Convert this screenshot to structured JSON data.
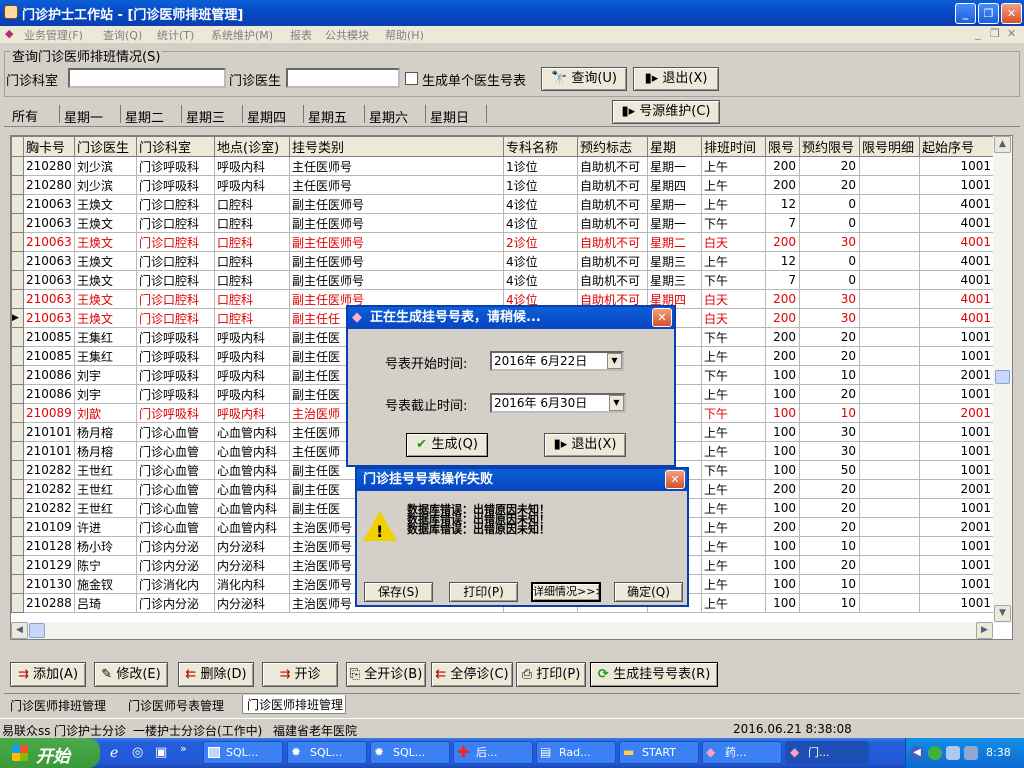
{
  "window": {
    "title": "门诊护士工作站 - [门诊医师排班管理]"
  },
  "menu": [
    {
      "label": "业务管理(F)"
    },
    {
      "label": "查询(Q)"
    },
    {
      "label": "统计(T)"
    },
    {
      "label": "系统维护(M)"
    },
    {
      "label": "报表"
    },
    {
      "label": "公共模块"
    },
    {
      "label": "帮助(H)"
    }
  ],
  "query": {
    "group_label": "查询门诊医师排班情况(S)",
    "dept_label": "门诊科室",
    "dept_value": "",
    "doctor_label": "门诊医生",
    "doctor_value": "",
    "single_checkbox_label": "生成单个医生号表",
    "query_button": "查询(U)",
    "exit_button": "退出(X)"
  },
  "day_tabs": [
    "所有",
    "星期一",
    "星期二",
    "星期三",
    "星期四",
    "星期五",
    "星期六",
    "星期日"
  ],
  "source_button": "号源维护(C)",
  "table": {
    "columns": [
      "胸卡号",
      "门诊医生",
      "门诊科室",
      "地点(诊室)",
      "挂号类别",
      "专科名称",
      "预约标志",
      "星期",
      "排班时间",
      "限号",
      "预约限号",
      "限号明细",
      "起始序号"
    ],
    "rows": [
      {
        "c": [
          "210280",
          "刘少滨",
          "门诊呼吸科",
          "呼吸内科",
          "主任医师号",
          "1诊位",
          "自助机不可",
          "星期一",
          "上午",
          "200",
          "20",
          "",
          "1001"
        ],
        "red": false
      },
      {
        "c": [
          "210280",
          "刘少滨",
          "门诊呼吸科",
          "呼吸内科",
          "主任医师号",
          "1诊位",
          "自助机不可",
          "星期四",
          "上午",
          "200",
          "20",
          "",
          "1001"
        ],
        "red": false
      },
      {
        "c": [
          "210063",
          "王焕文",
          "门诊口腔科",
          "口腔科",
          "副主任医师号",
          "4诊位",
          "自助机不可",
          "星期一",
          "上午",
          "12",
          "0",
          "",
          "4001"
        ],
        "red": false
      },
      {
        "c": [
          "210063",
          "王焕文",
          "门诊口腔科",
          "口腔科",
          "副主任医师号",
          "4诊位",
          "自助机不可",
          "星期一",
          "下午",
          "7",
          "0",
          "",
          "4001"
        ],
        "red": false
      },
      {
        "c": [
          "210063",
          "王焕文",
          "门诊口腔科",
          "口腔科",
          "副主任医师号",
          "2诊位",
          "自助机不可",
          "星期二",
          "白天",
          "200",
          "30",
          "",
          "4001"
        ],
        "red": true
      },
      {
        "c": [
          "210063",
          "王焕文",
          "门诊口腔科",
          "口腔科",
          "副主任医师号",
          "4诊位",
          "自助机不可",
          "星期三",
          "上午",
          "12",
          "0",
          "",
          "4001"
        ],
        "red": false
      },
      {
        "c": [
          "210063",
          "王焕文",
          "门诊口腔科",
          "口腔科",
          "副主任医师号",
          "4诊位",
          "自助机不可",
          "星期三",
          "下午",
          "7",
          "0",
          "",
          "4001"
        ],
        "red": false
      },
      {
        "c": [
          "210063",
          "王焕文",
          "门诊口腔科",
          "口腔科",
          "副主任医师号",
          "4诊位",
          "自助机不可",
          "星期四",
          "白天",
          "200",
          "30",
          "",
          "4001"
        ],
        "red": true
      },
      {
        "c": [
          "210063",
          "王焕文",
          "门诊口腔科",
          "口腔科",
          "副主任任",
          "",
          "",
          "五",
          "白天",
          "200",
          "30",
          "",
          "4001"
        ],
        "red": true
      },
      {
        "c": [
          "210085",
          "王集红",
          "门诊呼吸科",
          "呼吸内科",
          "副主任医",
          "",
          "",
          "",
          "下午",
          "200",
          "20",
          "",
          "1001"
        ],
        "red": false
      },
      {
        "c": [
          "210085",
          "王集红",
          "门诊呼吸科",
          "呼吸内科",
          "副主任医",
          "",
          "",
          "三",
          "上午",
          "200",
          "20",
          "",
          "1001"
        ],
        "red": false
      },
      {
        "c": [
          "210086",
          "刘宇",
          "门诊呼吸科",
          "呼吸内科",
          "副主任医",
          "",
          "",
          "四",
          "下午",
          "100",
          "10",
          "",
          "2001"
        ],
        "red": false
      },
      {
        "c": [
          "210086",
          "刘宇",
          "门诊呼吸科",
          "呼吸内科",
          "副主任医",
          "",
          "",
          "五",
          "上午",
          "100",
          "20",
          "",
          "1001"
        ],
        "red": false
      },
      {
        "c": [
          "210089",
          "刘歆",
          "门诊呼吸科",
          "呼吸内科",
          "主治医师",
          "",
          "",
          "二",
          "下午",
          "100",
          "10",
          "",
          "2001"
        ],
        "red": true
      },
      {
        "c": [
          "210101",
          "杨月榕",
          "门诊心血管",
          "心血管内科",
          "主任医师",
          "",
          "",
          "一",
          "上午",
          "100",
          "30",
          "",
          "1001"
        ],
        "red": false
      },
      {
        "c": [
          "210101",
          "杨月榕",
          "门诊心血管",
          "心血管内科",
          "主任医师",
          "",
          "",
          "",
          "上午",
          "100",
          "30",
          "",
          "1001"
        ],
        "red": false
      },
      {
        "c": [
          "210282",
          "王世红",
          "门诊心血管",
          "心血管内科",
          "副主任医",
          "",
          "",
          "",
          "下午",
          "100",
          "50",
          "",
          "1001"
        ],
        "red": false
      },
      {
        "c": [
          "210282",
          "王世红",
          "门诊心血管",
          "心血管内科",
          "副主任医",
          "",
          "",
          "",
          "上午",
          "200",
          "20",
          "",
          "2001"
        ],
        "red": false
      },
      {
        "c": [
          "210282",
          "王世红",
          "门诊心血管",
          "心血管内科",
          "副主任医",
          "",
          "",
          "",
          "上午",
          "100",
          "20",
          "",
          "1001"
        ],
        "red": false
      },
      {
        "c": [
          "210109",
          "许进",
          "门诊心血管",
          "心血管内科",
          "主治医师号",
          "",
          "",
          "",
          "上午",
          "200",
          "20",
          "",
          "2001"
        ],
        "red": false
      },
      {
        "c": [
          "210128",
          "杨小玲",
          "门诊内分泌",
          "内分泌科",
          "主治医师号",
          "",
          "",
          "",
          "上午",
          "100",
          "10",
          "",
          "1001"
        ],
        "red": false
      },
      {
        "c": [
          "210129",
          "陈宁",
          "门诊内分泌",
          "内分泌科",
          "主治医师号",
          "",
          "",
          "",
          "上午",
          "100",
          "20",
          "",
          "1001"
        ],
        "red": false
      },
      {
        "c": [
          "210130",
          "施金钗",
          "门诊消化内",
          "消化内科",
          "主治医师号",
          "",
          "",
          "",
          "上午",
          "100",
          "10",
          "",
          "1001"
        ],
        "red": false
      },
      {
        "c": [
          "210288",
          "吕琦",
          "门诊内分泌",
          "内分泌科",
          "主治医师号",
          "",
          "",
          "",
          "上午",
          "100",
          "10",
          "",
          "1001"
        ],
        "red": false
      }
    ]
  },
  "gen_dialog": {
    "title": "正在生成挂号号表，请稍候...",
    "start_label": "号表开始时间:",
    "start_value": "2016年 6月22日",
    "end_label": "号表截止时间:",
    "end_value": "2016年 6月30日",
    "gen_button": "生成(Q)",
    "exit_button": "退出(X)"
  },
  "err_dialog": {
    "title": "门诊挂号号表操作失败",
    "lines": [
      "数据库错误：出错原因未知！",
      "数据库错误：出错原因未知！",
      "数据库错误：出错原因未知！"
    ],
    "save_button": "保存(S)",
    "print_button": "打印(P)",
    "detail_button": "详细情况>>>",
    "ok_button": "确定(Q)"
  },
  "action_buttons": [
    "添加(A)",
    "修改(E)",
    "删除(D)",
    "开诊",
    "全开诊(B)",
    "全停诊(C)",
    "打印(P)",
    "生成挂号号表(R)"
  ],
  "bottom_tabs": [
    "门诊医师排班管理",
    "门诊医师号表管理",
    "门诊医师排班管理"
  ],
  "status": {
    "user": "易联众ss",
    "unit": "门诊护士分诊",
    "station": "一楼护士分诊台(工作中)",
    "hospital": "福建省老年医院",
    "datetime": "2016.06.21  8:38:08"
  },
  "taskbar": {
    "start_label": "开始",
    "buttons": [
      "SQL...",
      "SQL...",
      "SQL...",
      "后...",
      "Rad...",
      "START",
      "药...",
      "门..."
    ],
    "clock": "8:38"
  },
  "colors": {
    "title_blue": "#0845c0",
    "row_red": "#e00000",
    "face": "#d4d0c8"
  }
}
